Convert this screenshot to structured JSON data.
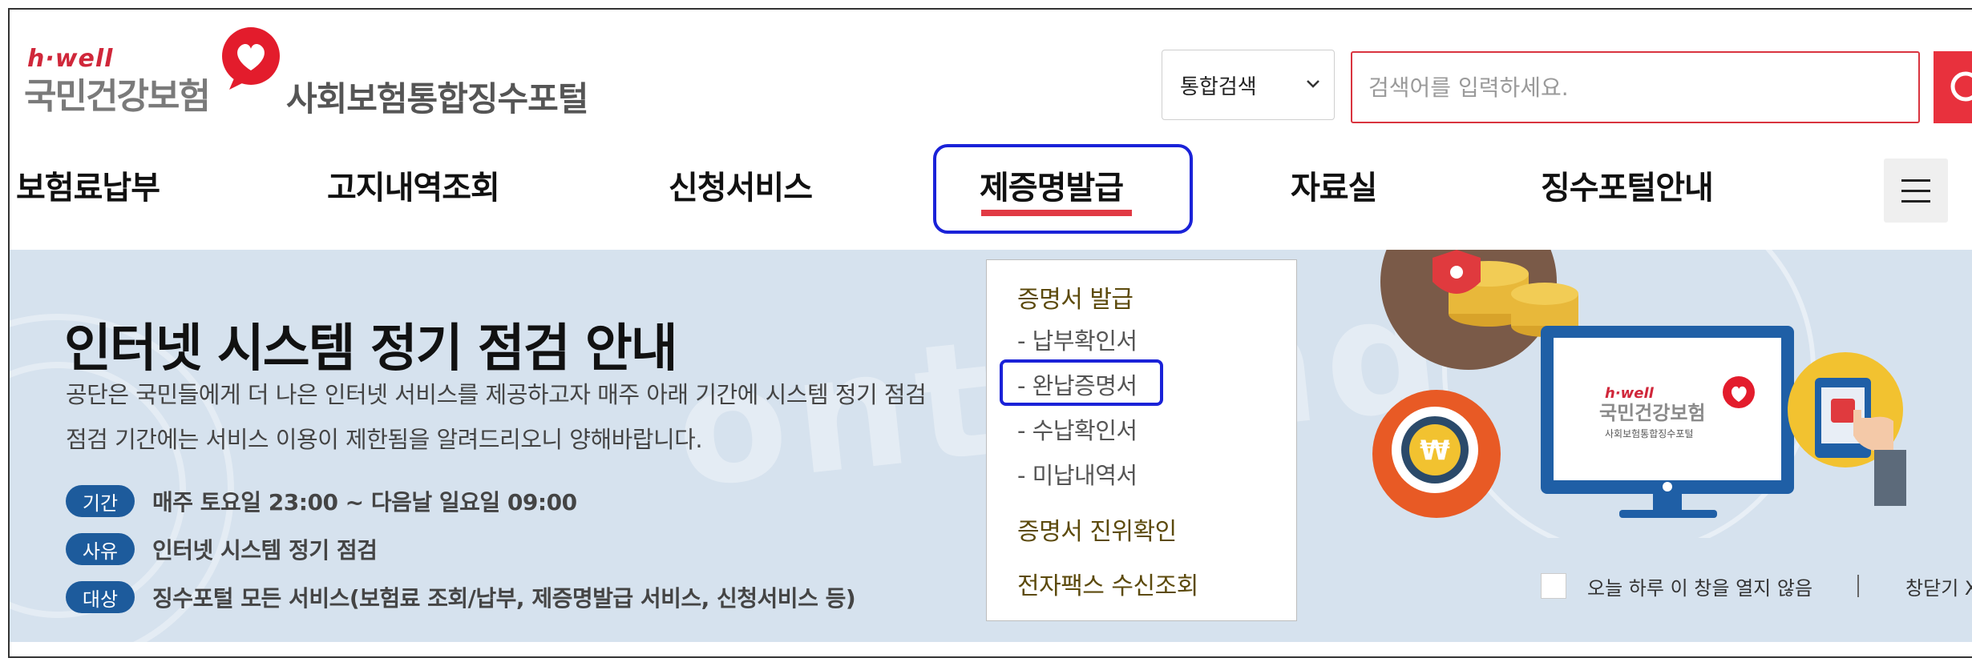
{
  "header": {
    "logo_brand": "h·well",
    "logo_org": "국민건강보험",
    "portal_title": "사회보험통합징수포털"
  },
  "search": {
    "category": "통합검색",
    "placeholder": "검색어를 입력하세요."
  },
  "nav": {
    "items": [
      "보험료납부",
      "고지내역조회",
      "신청서비스",
      "제증명발급",
      "자료실",
      "징수포털안내"
    ],
    "active": "제증명발급"
  },
  "dropdown": {
    "section1": "증명서 발급",
    "items": [
      "- 납부확인서",
      "- 완납증명서",
      "- 수납확인서",
      "- 미납내역서"
    ],
    "highlighted": "- 완납증명서",
    "section2": "증명서 진위확인",
    "section3": "전자팩스 수신조회"
  },
  "banner": {
    "title": "인터넷 시스템 정기 점검 안내",
    "desc_line1": "공단은 국민들에게 더 나은 인터넷 서비스를 제공하고자 매주 아래 기간에 시스템 정기 점검",
    "desc_line2": "점검 기간에는 서비스 이용이 제한됨을 알려드리오니 양해바랍니다.",
    "rows": [
      {
        "tag": "기간",
        "text": "매주 토요일 23:00 ~ 다음날 일요일 09:00"
      },
      {
        "tag": "사유",
        "text": "인터넷 시스템 정기 점검"
      },
      {
        "tag": "대상",
        "text": "징수포털 모든 서비스(보험료 조회/납부, 제증명발급 서비스, 신청서비스 등)"
      }
    ],
    "illustration": {
      "monitor_brand": "h·well",
      "monitor_org": "국민건강보험",
      "monitor_portal": "사회보험통합징수포털"
    },
    "dont_show_today": "오늘 하루 이 창을 열지 않음",
    "close_label": "창닫기 X"
  },
  "colors": {
    "accent_red": "#e8313d",
    "highlight_blue": "#1a22d8",
    "pill_blue": "#1d5b9c",
    "banner_bg": "#d6e2ee",
    "dropdown_heading": "#5c4a0c"
  }
}
